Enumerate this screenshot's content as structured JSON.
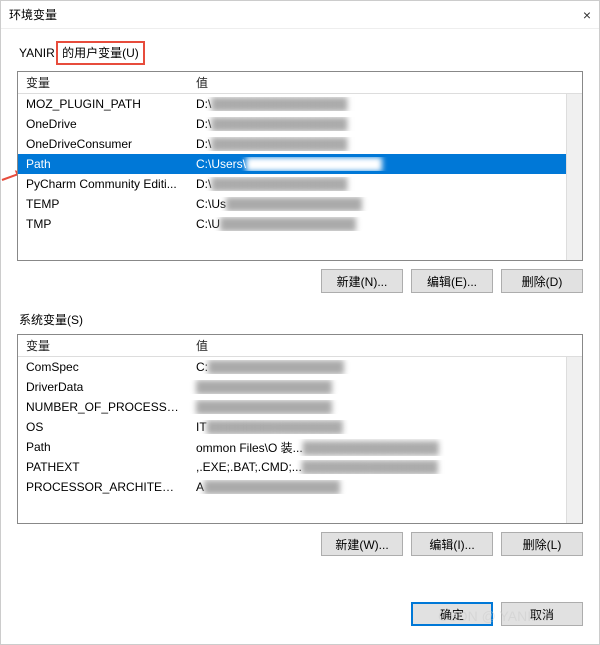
{
  "title": "环境变量",
  "close_symbol": "×",
  "user_section": {
    "label_prefix": "YANIR ",
    "label_highlight": "的用户变量(U)",
    "header_var": "变量",
    "header_val": "值",
    "rows": [
      {
        "name": "MOZ_PLUGIN_PATH",
        "value": "D:\\",
        "selected": false
      },
      {
        "name": "OneDrive",
        "value": "D:\\",
        "selected": false
      },
      {
        "name": "OneDriveConsumer",
        "value": "D:\\",
        "selected": false
      },
      {
        "name": "Path",
        "value": "C:\\Users\\",
        "selected": true
      },
      {
        "name": "PyCharm Community Editi...",
        "value": "D:\\",
        "selected": false
      },
      {
        "name": "TEMP",
        "value": "C:\\Us",
        "selected": false
      },
      {
        "name": "TMP",
        "value": "C:\\U",
        "selected": false
      }
    ],
    "btn_new": "新建(N)...",
    "btn_edit": "编辑(E)...",
    "btn_delete": "删除(D)"
  },
  "system_section": {
    "label": "系统变量(S)",
    "header_var": "变量",
    "header_val": "值",
    "rows": [
      {
        "name": "ComSpec",
        "value": "C:"
      },
      {
        "name": "DriverData",
        "value": ""
      },
      {
        "name": "NUMBER_OF_PROCESSORS",
        "value": ""
      },
      {
        "name": "OS",
        "value": "        IT"
      },
      {
        "name": "Path",
        "value": "             ommon Files\\O                                   装..."
      },
      {
        "name": "PATHEXT",
        "value": "  ,.EXE;.BAT;.CMD;..."
      },
      {
        "name": "PROCESSOR_ARCHITECT...",
        "value": "A"
      }
    ],
    "btn_new": "新建(W)...",
    "btn_edit": "编辑(I)...",
    "btn_delete": "删除(L)"
  },
  "ok": "确定",
  "cancel": "取消",
  "watermark": "CSDN @ YANIR7"
}
